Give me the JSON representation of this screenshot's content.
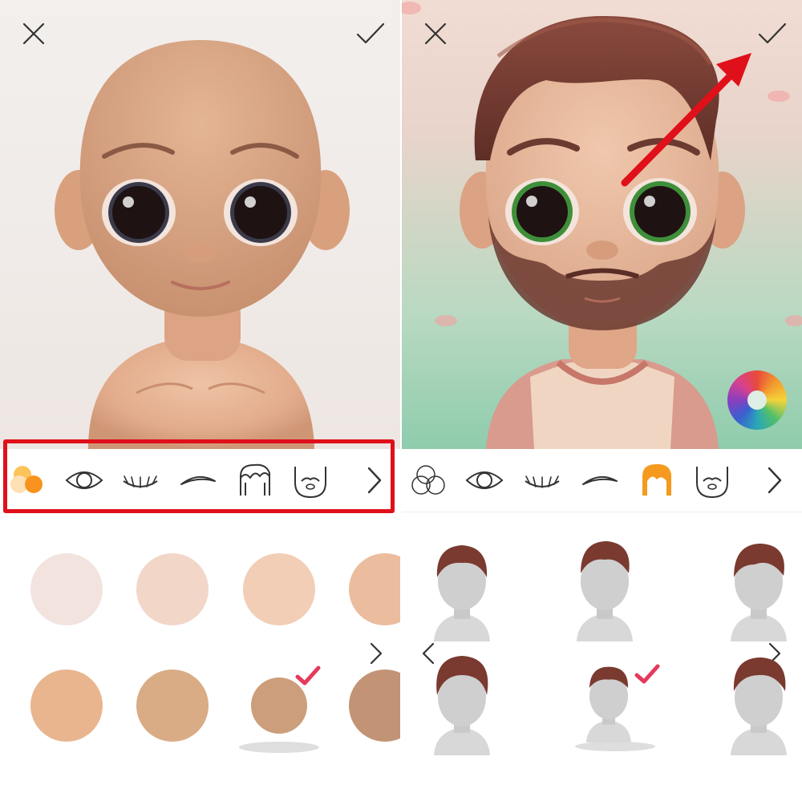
{
  "left_panel": {
    "close_icon": "close-icon",
    "confirm_icon": "checkmark-icon",
    "toolbar": {
      "items": [
        "skin-color-icon",
        "eye-icon",
        "eyelash-icon",
        "eyebrow-icon",
        "hair-icon",
        "beard-icon",
        "chevron-right-icon"
      ],
      "active_item": "skin-color-icon",
      "highlight_color": "#e0101a"
    },
    "skin_swatches": {
      "colors": [
        "#f3e3df",
        "#f2d6c8",
        "#f2ceb6",
        "#ebbd9e",
        "#e9b58f",
        "#d9ac86",
        "#cc9e7b",
        "#c29475"
      ],
      "selected_index": 6,
      "selected_check_color": "#e43a5c"
    },
    "page_arrow_icon": "chevron-right-icon"
  },
  "right_panel": {
    "close_icon": "close-icon",
    "confirm_icon": "checkmark-icon",
    "annotation": "red-arrow-pointing-to-confirm",
    "color_wheel_icon": "color-wheel-icon",
    "toolbar": {
      "items": [
        "skin-color-icon",
        "eye-icon",
        "eyelash-icon",
        "eyebrow-icon",
        "hair-icon",
        "beard-icon",
        "chevron-right-icon"
      ],
      "active_item": "hair-icon",
      "active_color": "#f59a1e"
    },
    "hairstyles": {
      "count_visible": 6,
      "selected_index": 4,
      "hair_color": "#7a3a30",
      "selected_check_color": "#e43a5c"
    },
    "prev_arrow_icon": "chevron-left-icon",
    "next_arrow_icon": "chevron-right-icon"
  },
  "colors": {
    "skin_base": "#e7b594",
    "eye_left": "#2a1a1a",
    "eye_right_iris_ring": "#3f8f3a",
    "shirt": "#d99b8e"
  }
}
